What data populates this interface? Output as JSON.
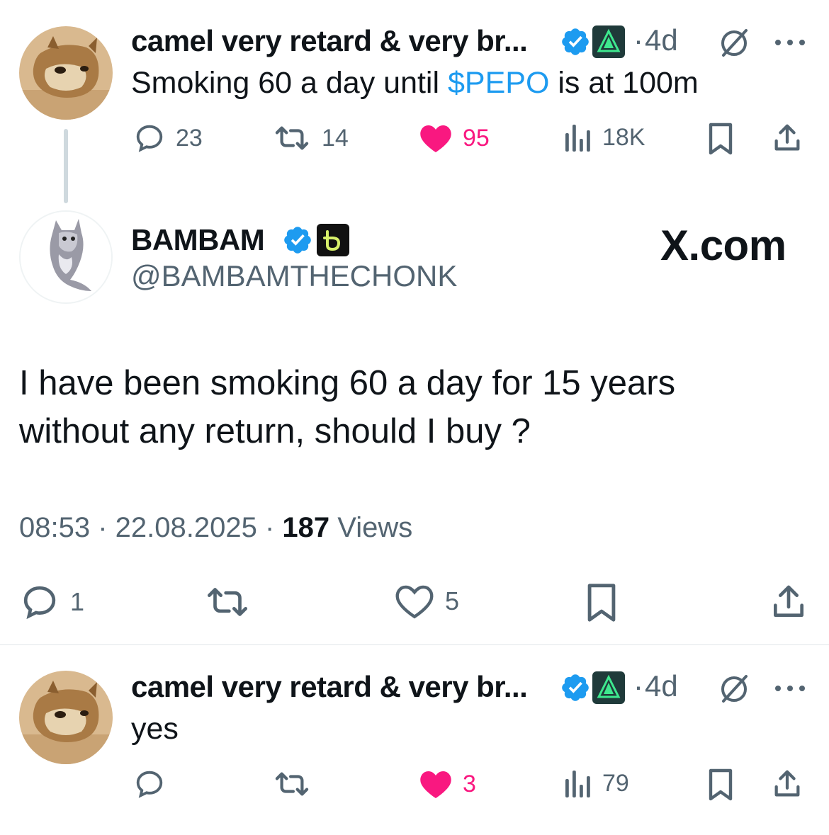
{
  "tweet1": {
    "name": "camel very retard & very br...",
    "separator": "·",
    "time": "4d",
    "text_before": "Smoking 60 a day until ",
    "cashtag": "$PEPO",
    "text_after": " is at 100m",
    "replies": "23",
    "retweets": "14",
    "likes": "95",
    "views": "18K",
    "more_icon": "more-icon",
    "grok_icon": "grok-icon"
  },
  "main": {
    "name": "BAMBAM",
    "handle": "@BAMBAMTHECHONK",
    "brand": "X.com",
    "text_line1": "I have been smoking 60 a day for 15 years",
    "text_line2": "without any return, should I buy ?",
    "time": "08:53",
    "sep1": " · ",
    "date": "22.08.2025",
    "sep2": " · ",
    "views_count": "187",
    "views_label": " Views",
    "replies": "1",
    "likes": "5"
  },
  "tweet2": {
    "name": "camel very retard & very br...",
    "separator": "·",
    "time": "4d",
    "text": "yes",
    "likes": "3",
    "views": "79"
  },
  "colors": {
    "accent": "#1d9bf0",
    "like": "#f91880",
    "muted": "#536471",
    "text": "#0f1419"
  }
}
